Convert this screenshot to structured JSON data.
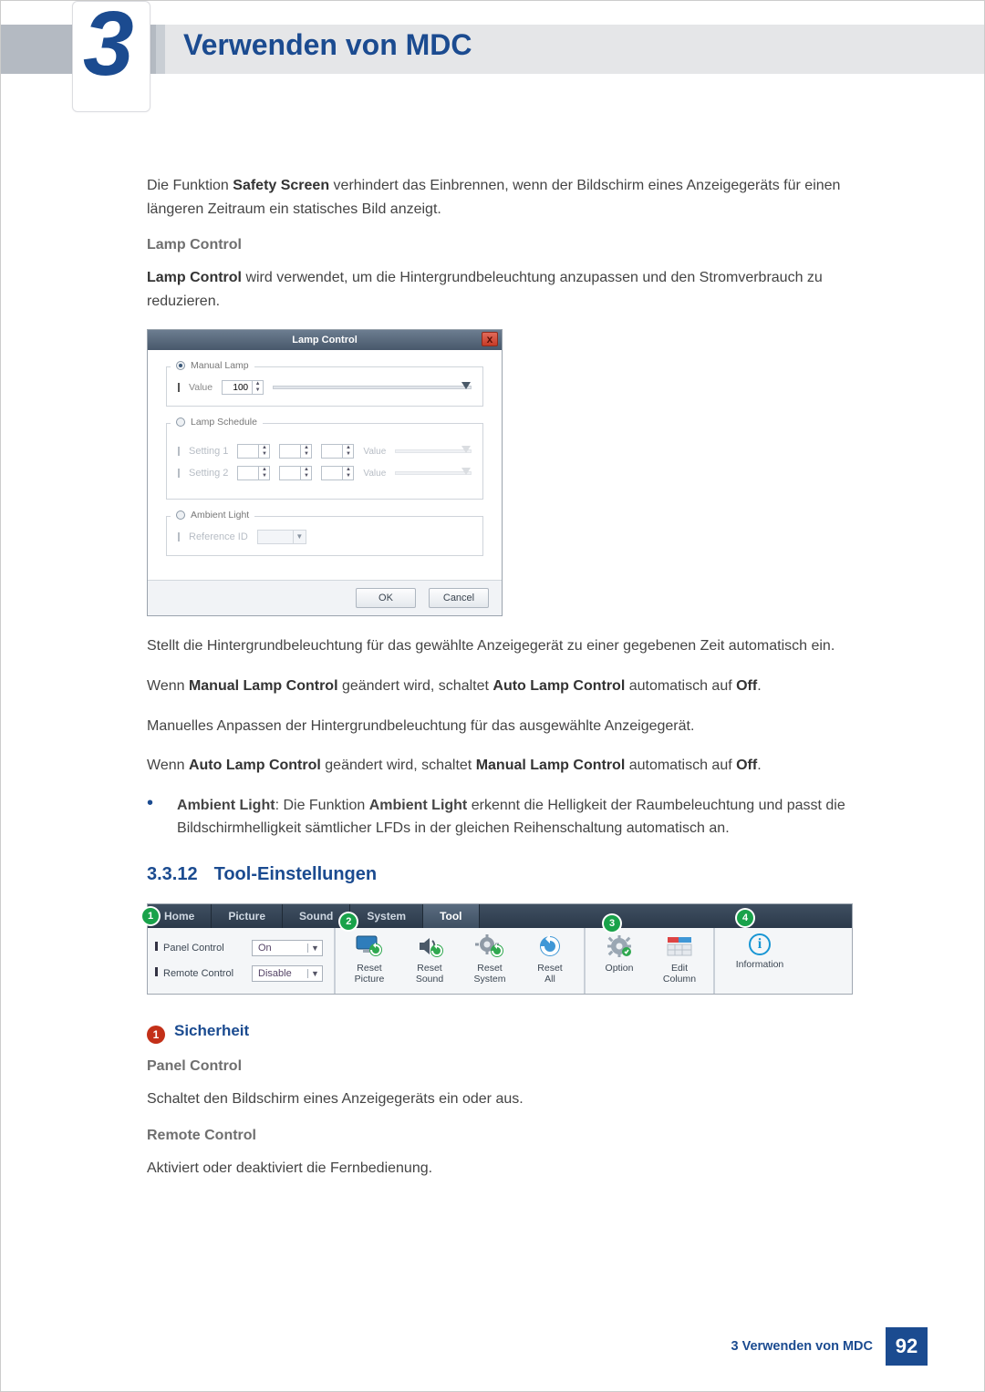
{
  "chapter": {
    "number": "3",
    "title": "Verwenden von MDC"
  },
  "p_safety": {
    "pre": "Die Funktion ",
    "bold": "Safety Screen",
    "post": " verhindert das Einbrennen, wenn der Bildschirm eines Anzeigegeräts für einen längeren Zeitraum ein statisches Bild anzeigt."
  },
  "h_lamp_control": "Lamp Control",
  "p_lamp_control": {
    "bold": "Lamp Control",
    "post": " wird verwendet, um die Hintergrundbeleuchtung anzupassen und den Stromverbrauch zu reduzieren."
  },
  "dialog": {
    "title": "Lamp Control",
    "close": "x",
    "manual": {
      "title": "Manual Lamp",
      "value_label": "Value",
      "value": "100"
    },
    "schedule": {
      "title": "Lamp Schedule",
      "rows": [
        {
          "label": "Setting 1",
          "value_label": "Value"
        },
        {
          "label": "Setting 2",
          "value_label": "Value"
        }
      ]
    },
    "ambient": {
      "title": "Ambient Light",
      "ref_label": "Reference ID"
    },
    "ok": "OK",
    "cancel": "Cancel"
  },
  "p_after_dialog": "Stellt die Hintergrundbeleuchtung für das gewählte Anzeigegerät zu einer gegebenen Zeit automatisch ein.",
  "p_manual_auto": {
    "pre": "Wenn ",
    "b1": "Manual Lamp Control",
    "mid": " geändert wird, schaltet ",
    "b2": "Auto Lamp Control",
    "mid2": " automatisch auf ",
    "b3": "Off",
    "post": "."
  },
  "p_manual_adjust": "Manuelles Anpassen der Hintergrundbeleuchtung für das ausgewählte Anzeigegerät.",
  "p_auto_manual": {
    "pre": "Wenn ",
    "b1": "Auto Lamp Control",
    "mid": " geändert wird, schaltet ",
    "b2": "Manual Lamp Control",
    "mid2": " automatisch auf ",
    "b3": "Off",
    "post": "."
  },
  "bullet_ambient": {
    "b1": "Ambient Light",
    "mid": ": Die Funktion ",
    "b2": "Ambient Light",
    "post": " erkennt die Helligkeit der Raumbeleuchtung und passt die Bildschirmhelligkeit sämtlicher LFDs in der gleichen Reihenschaltung automatisch an."
  },
  "section_3312": {
    "num": "3.3.12",
    "title": "Tool-Einstellungen"
  },
  "toolbar": {
    "tabs": [
      "Home",
      "Picture",
      "Sound",
      "System",
      "Tool"
    ],
    "callouts": {
      "c1": "1",
      "c2": "2",
      "c3": "3",
      "c4": "4"
    },
    "panel_control": {
      "label": "Panel Control",
      "value": "On"
    },
    "remote_control": {
      "label": "Remote Control",
      "value": "Disable"
    },
    "buttons": {
      "reset_picture": "Reset\nPicture",
      "reset_sound": "Reset\nSound",
      "reset_system": "Reset\nSystem",
      "reset_all": "Reset\nAll",
      "option": "Option",
      "edit_column": "Edit\nColumn",
      "information": "Information"
    }
  },
  "h_sicherheit": {
    "num": "1",
    "title": "Sicherheit"
  },
  "sub_panel": "Panel Control",
  "p_panel": "Schaltet den Bildschirm eines Anzeigegeräts ein oder aus.",
  "sub_remote": "Remote Control",
  "p_remote": "Aktiviert oder deaktiviert die Fernbedienung.",
  "footer": {
    "text": "3 Verwenden von MDC",
    "page": "92"
  }
}
